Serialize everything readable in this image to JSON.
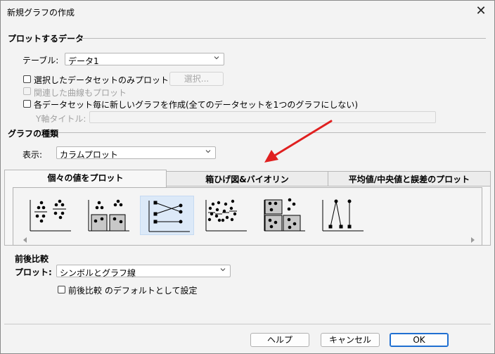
{
  "window": {
    "title": "新規グラフの作成",
    "close_glyph": "✕"
  },
  "plot_data": {
    "section_label": "プロットするデータ",
    "table_label": "テーブル:",
    "table_value": "データ1",
    "only_selected_label": "選択したデータセットのみプロット",
    "select_button": "選択...",
    "related_curves_label": "関連した曲線もプロット",
    "each_dataset_label": "各データセット毎に新しいグラフを作成(全てのデータセットを1つのグラフにしない)",
    "y_axis_title_label": "Y軸タイトル:",
    "y_axis_title_value": ""
  },
  "graph_type": {
    "section_label": "グラフの種類",
    "display_label": "表示:",
    "display_value": "カラムプロット"
  },
  "tabs": [
    {
      "label": "個々の値をプロット",
      "active": true
    },
    {
      "label": "箱ひげ図&バイオリン",
      "active": false
    },
    {
      "label": "平均値/中央値と誤差のプロット",
      "active": false
    }
  ],
  "gallery": {
    "items": [
      {
        "icon": "scatter-two-columns-icon",
        "selected": false
      },
      {
        "icon": "scatter-shaded-columns-icon",
        "selected": false
      },
      {
        "icon": "before-after-lines-icon",
        "selected": true
      },
      {
        "icon": "scatter-four-columns-icon",
        "selected": false
      },
      {
        "icon": "scatter-shaded-grid-icon",
        "selected": false
      },
      {
        "icon": "before-after-peak-lines-icon",
        "selected": false
      }
    ]
  },
  "before_after": {
    "section_label": "前後比較",
    "plot_label": "プロット:",
    "plot_value": "シンボルとグラフ線",
    "default_label": "前後比較 のデフォルトとして設定"
  },
  "footer": {
    "help_button": "ヘルプ",
    "cancel_button": "キャンセル",
    "ok_button": "OK"
  },
  "annotation": {
    "arrow_color": "#e02020"
  }
}
